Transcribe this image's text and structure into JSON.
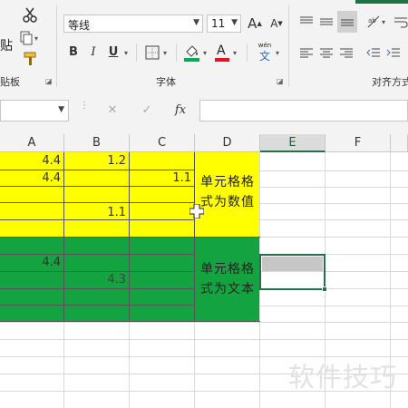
{
  "ribbon": {
    "clipboard": {
      "paste_label": "贴",
      "group_label": "贴板"
    },
    "font": {
      "font_name": "等线",
      "font_size": "11",
      "grow_label": "A",
      "shrink_label": "A",
      "bold": "B",
      "italic": "I",
      "underline": "U",
      "font_color_letter": "A",
      "wen_top": "wén",
      "wen_bottom": "文",
      "group_label": "字体"
    },
    "alignment": {
      "group_label": "对齐方式"
    }
  },
  "formula_bar": {
    "cancel": "✕",
    "enter": "✓",
    "fx": "fx"
  },
  "columns": [
    "A",
    "B",
    "C",
    "D",
    "E",
    "F"
  ],
  "selected_column": "E",
  "cells": {
    "r1": {
      "A": "4.4",
      "B": "1.2"
    },
    "r2": {
      "A": "4.4",
      "C": "1.1"
    },
    "r3": {
      "B": "1.1"
    },
    "r6": {
      "A": "4.4"
    },
    "r7": {
      "B": "4.3"
    }
  },
  "merged": {
    "numeric_line1": "单元格格",
    "numeric_line2": "式为数值",
    "text_line1": "单元格格",
    "text_line2": "式为文本"
  },
  "colors": {
    "yellow": "#ffff00",
    "green": "#14a341",
    "excel_green": "#217346"
  },
  "watermark": "软件技巧"
}
